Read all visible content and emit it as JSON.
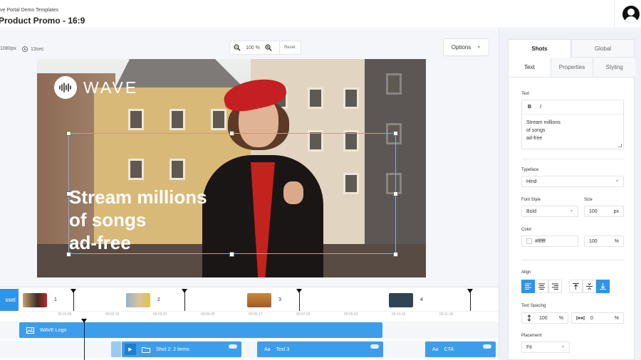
{
  "header": {
    "breadcrumb": "ve Portal Demo Templates",
    "title": "Product Promo - 16:9"
  },
  "canvas": {
    "size": "1080px",
    "duration": "13sec",
    "zoom": "100 %",
    "zoom_reset": "Reset",
    "options_label": "Options",
    "logo_text": "WAVE",
    "overlay_lines": [
      "Stream millions",
      "of songs",
      "ad-free"
    ]
  },
  "panel": {
    "main_tabs": [
      "Shots",
      "Global"
    ],
    "sub_tabs": [
      "Text",
      "Properties",
      "Styling"
    ],
    "text_label": "Text",
    "bold": "B",
    "italic": "I",
    "text_lines": [
      "Stream millions",
      "of songs",
      "ad-free"
    ],
    "typeface_label": "Typeface",
    "typeface_value": "Hind",
    "font_style_label": "Font Style",
    "font_style_value": "Bold",
    "size_label": "Size",
    "size_value": "100",
    "size_unit": "px",
    "color_label": "Color",
    "color_value": "#ffffff",
    "opacity_value": "100",
    "opacity_unit": "%",
    "align_label": "Align",
    "spacing_label": "Text Spacing",
    "line_spacing_value": "100",
    "line_spacing_unit": "%",
    "letter_spacing_value": "0",
    "letter_spacing_unit": "%",
    "placement_label": "Placement",
    "placement_value": "Fit"
  },
  "timeline": {
    "asset_label": "sset",
    "shots": [
      "1",
      "2",
      "3",
      "4"
    ],
    "ticks": [
      "00:01:08",
      "00:02:15",
      "00:03:23",
      "00:05:05",
      "00:06:13",
      "00:07:20",
      "00:09:03",
      "00:10:10",
      "00:11:18"
    ],
    "track_logo": "WAVE Logo",
    "track_shot": "Shot 2:",
    "track_shot_items": "2 items",
    "track_text3_prefix": "Aa",
    "track_text3": "Text 3",
    "track_cta_prefix": "Aa",
    "track_cta": "CTA"
  },
  "colors": {
    "accent": "#2f95e8",
    "track": "#3d9de9",
    "selection": "#7bb0e8"
  }
}
